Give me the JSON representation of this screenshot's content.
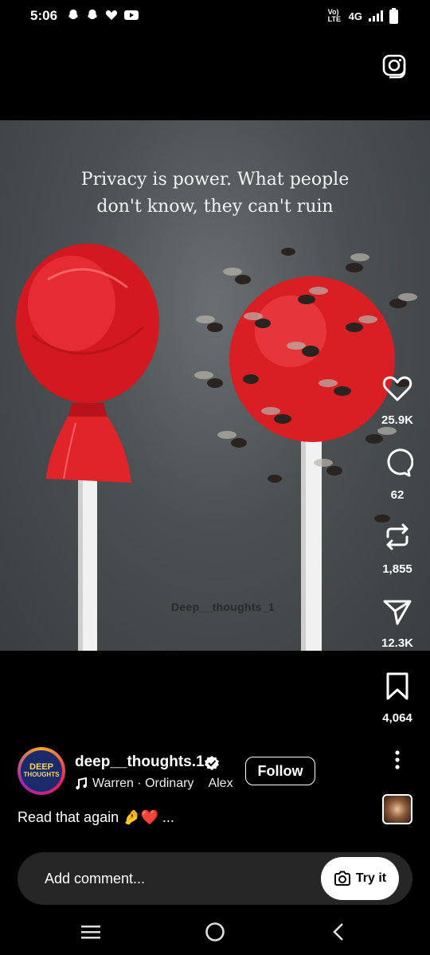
{
  "status_bar": {
    "time": "5:06",
    "network": "4G",
    "lte_label": "Vo) LTE"
  },
  "post": {
    "quote_line1": "Privacy is power. What people",
    "quote_line2": "don't know, they can't ruin",
    "watermark": "Deep__thoughts_1"
  },
  "actions": {
    "likes": "25.9K",
    "comments": "62",
    "reposts": "1,855",
    "shares": "12.3K",
    "saves": "4,064"
  },
  "author": {
    "username": "deep__thoughts.1",
    "avatar_line1": "DEEP",
    "avatar_line2": "THOUGHTS",
    "music_artist": "Warren · Ordinary",
    "music_extra": "Alex",
    "follow_label": "Follow"
  },
  "caption": {
    "text": "Read that again 🤌❤️ ..."
  },
  "comment": {
    "placeholder": "Add comment...",
    "try_label": "Try it"
  },
  "colors": {
    "candy_red": "#e0242a",
    "background": "#000000",
    "input_bg": "#262626"
  }
}
